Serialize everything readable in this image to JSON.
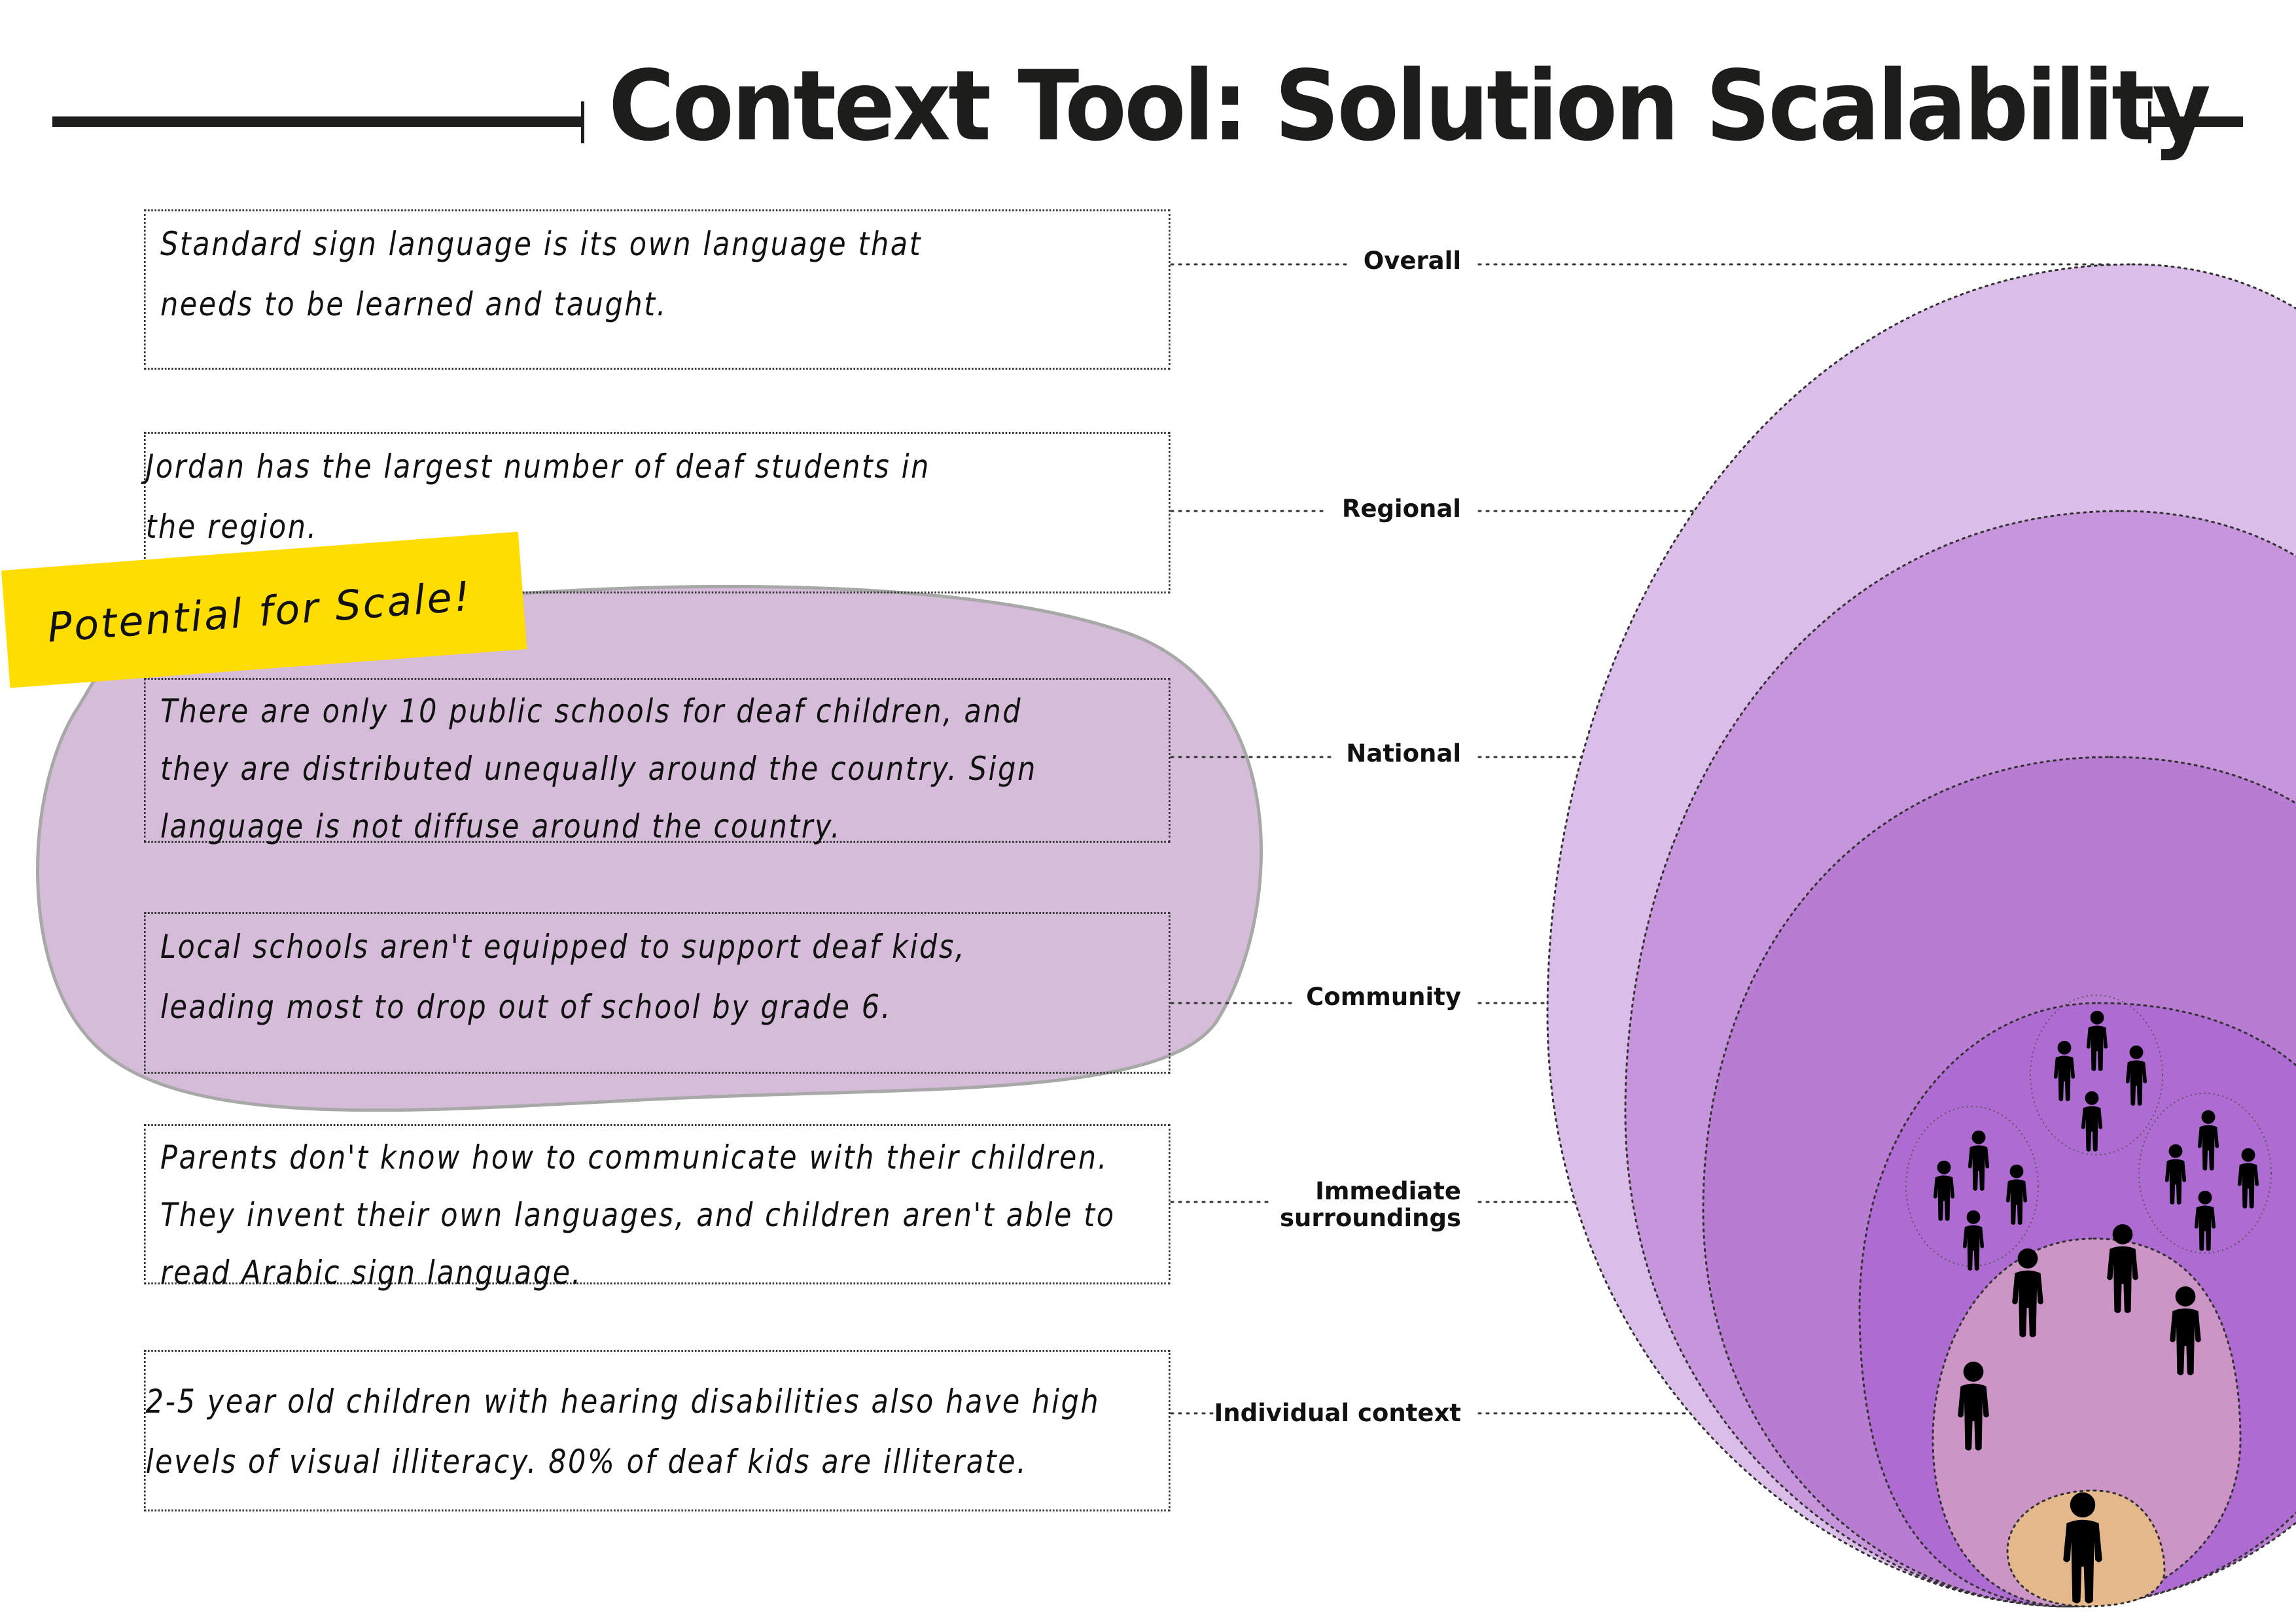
{
  "title": "Context Tool: Solution Scalability",
  "highlight": {
    "label": "Potential for Scale!",
    "color": "#ffdd00",
    "blob_color": "#d5bcd9"
  },
  "notes": [
    {
      "level": "Overall",
      "lines": [
        "Standard sign language is its own language that",
        "needs to be learned and taught."
      ]
    },
    {
      "level": "Regional",
      "lines": [
        "Jordan has the largest number of deaf students in",
        "the region."
      ]
    },
    {
      "level": "National",
      "lines": [
        "There are only 10 public schools for deaf children, and",
        "they are distributed unequally around the country. Sign",
        "language is not diffuse around the country."
      ]
    },
    {
      "level": "Community",
      "lines": [
        "Local schools aren't equipped to support deaf kids,",
        "leading most to drop out of school by grade 6."
      ]
    },
    {
      "level": "Immediate surroundings",
      "lines": [
        "Parents don't know how to communicate with their children.",
        "They invent their own languages, and children aren't able to",
        "read Arabic sign language."
      ]
    },
    {
      "level": "Individual context",
      "lines": [
        "2-5 year old children with hearing disabilities also have high",
        "levels of visual illiteracy. 80% of deaf kids are illiterate."
      ]
    }
  ],
  "levels": {
    "overall": "Overall",
    "regional": "Regional",
    "national": "National",
    "community": "Community",
    "immediate_1": "Immediate",
    "immediate_2": "surroundings",
    "individual": "Individual context"
  },
  "layer_colors": {
    "overall": "#dbbde9",
    "regional": "#c795dc",
    "national": "#b97cd3",
    "community": "#ae6bd1",
    "immediate": "#cd94c6",
    "individual": "#e4b88b"
  },
  "icons": {
    "person": "person-icon"
  }
}
